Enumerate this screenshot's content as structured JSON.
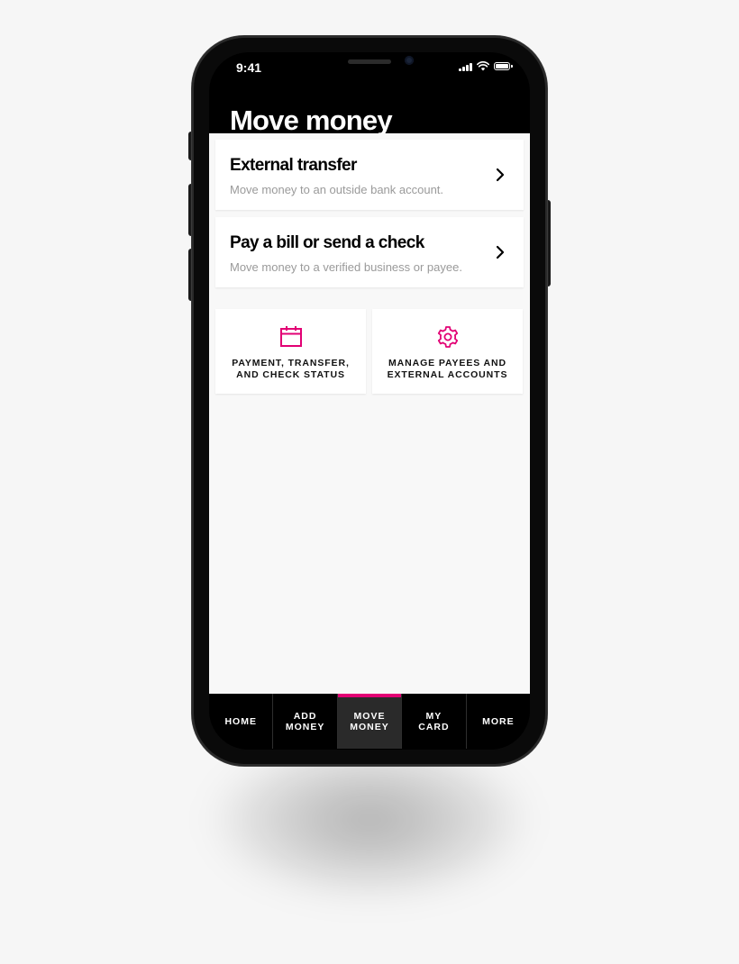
{
  "status_bar": {
    "time": "9:41"
  },
  "page": {
    "title": "Move money"
  },
  "actions": [
    {
      "title": "External transfer",
      "subtitle": "Move money to an outside bank account."
    },
    {
      "title": "Pay a bill or send a check",
      "subtitle": "Move money to a verified business or payee."
    }
  ],
  "tiles": [
    {
      "label": "PAYMENT, TRANSFER,\nAND CHECK STATUS",
      "icon": "calendar-icon"
    },
    {
      "label": "MANAGE PAYEES AND\nEXTERNAL ACCOUNTS",
      "icon": "gear-icon"
    }
  ],
  "tabs": [
    {
      "label": "HOME"
    },
    {
      "label": "ADD\nMONEY"
    },
    {
      "label": "MOVE\nMONEY",
      "active": true
    },
    {
      "label": "MY\nCARD"
    },
    {
      "label": "MORE"
    }
  ],
  "colors": {
    "accent": "#e20074",
    "background": "#f8f8f8",
    "header": "#000000"
  }
}
